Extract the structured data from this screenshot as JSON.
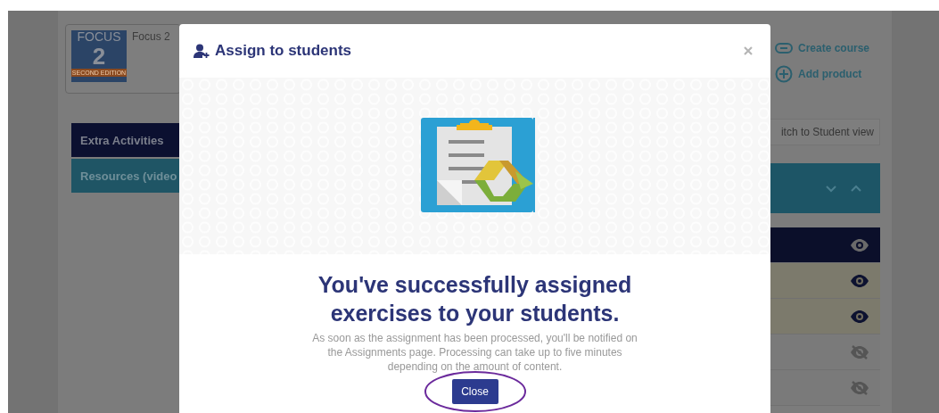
{
  "course": {
    "logo_word": "FOCUS",
    "logo_number": "2",
    "logo_edition": "SECOND EDITION",
    "title": "Focus 2"
  },
  "actions": [
    {
      "label": "Create course",
      "kind": "link"
    },
    {
      "label": "Add product",
      "kind": "add"
    }
  ],
  "sidebar": {
    "items": [
      {
        "label": "Extra Activities",
        "selected": true
      },
      {
        "label": "Resources (video",
        "selected": false
      }
    ]
  },
  "view_switch": {
    "label": "itch to Student view"
  },
  "lessons": [
    {
      "selected": true,
      "visible": true
    },
    {
      "selected": false,
      "visible": true
    },
    {
      "selected": false,
      "visible": true
    },
    {
      "selected": false,
      "visible": false
    },
    {
      "selected": false,
      "visible": false
    }
  ],
  "modal": {
    "title": "Assign to students",
    "heading": "You've successfully assigned exercises to your students.",
    "message": "As soon as the assignment has been processed, you'll be notified on the Assignments page. Processing can take up to five minutes depending on the amount of content.",
    "button": "Close"
  }
}
